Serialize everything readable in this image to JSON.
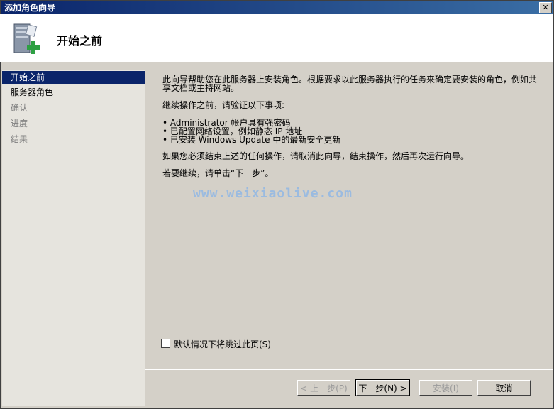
{
  "window": {
    "title": "添加角色向导",
    "close_glyph": "✕"
  },
  "header": {
    "title": "开始之前",
    "icon": "server-add-icon"
  },
  "nav": {
    "items": [
      {
        "label": "开始之前",
        "state": "active"
      },
      {
        "label": "服务器角色",
        "state": "normal"
      },
      {
        "label": "确认",
        "state": "disabled"
      },
      {
        "label": "进度",
        "state": "disabled"
      },
      {
        "label": "结果",
        "state": "disabled"
      }
    ]
  },
  "content": {
    "intro_line1": "此向导帮助您在此服务器上安装角色。根据要求以此服务器执行的任务来确定要安装的角色，例如共",
    "intro_line2": "享文档或主持网站。",
    "verify_heading": "继续操作之前，请验证以下事项:",
    "bullet1": "• Administrator 帐户具有强密码",
    "bullet2": "• 已配置网络设置，例如静态 IP 地址",
    "bullet3": "• 已安装 Windows Update 中的最新安全更新",
    "cancel_note": "如果您必须结束上述的任何操作，请取消此向导，结束操作，然后再次运行向导。",
    "continue_note": "若要继续，请单击“下一步”。",
    "watermark": "www.weixiaolive.com"
  },
  "skip_checkbox": {
    "label": "默认情况下将跳过此页(S)",
    "checked": false
  },
  "buttons": {
    "prev": "< 上一步(P)",
    "next": "下一步(N) >",
    "install": "安装(I)",
    "cancel": "取消"
  },
  "colors": {
    "titlebar": "#0a246a",
    "nav_active": "#0a246a",
    "panel": "#d4d0c8",
    "watermark": "#9bbbe0"
  }
}
